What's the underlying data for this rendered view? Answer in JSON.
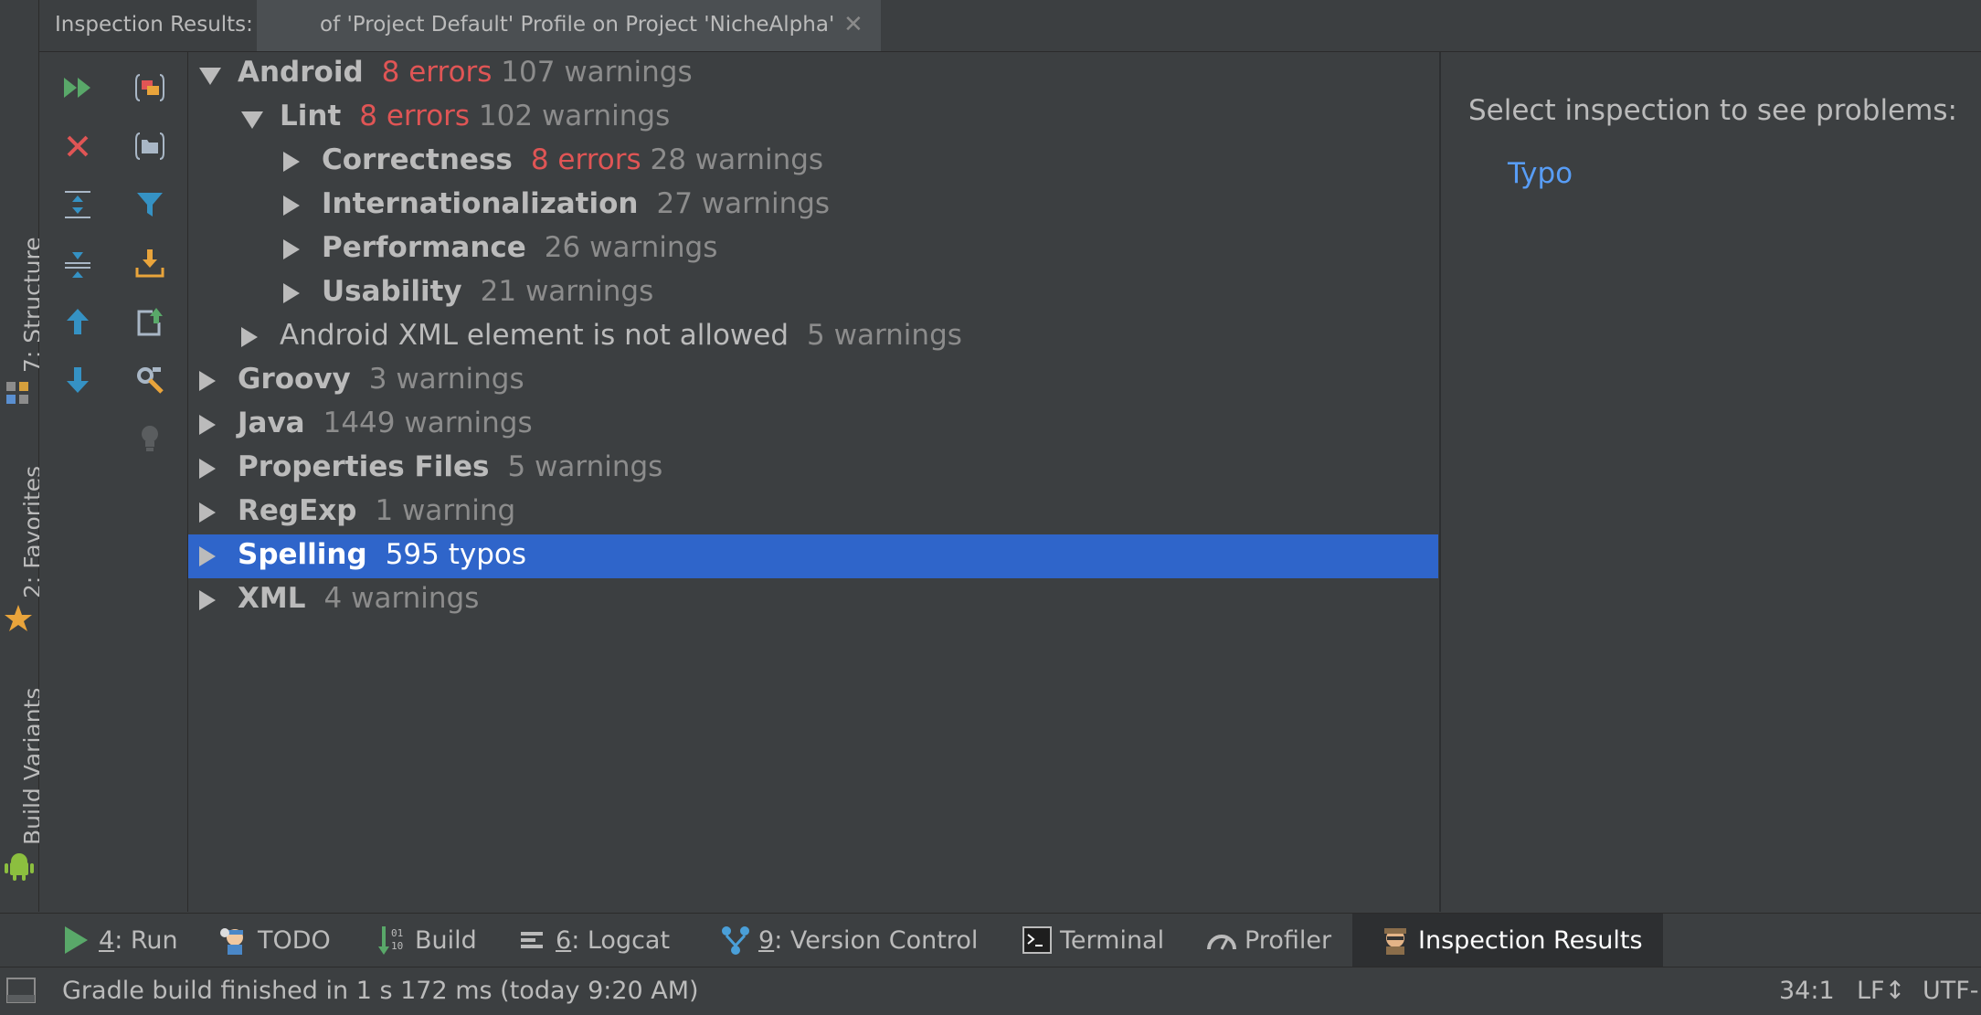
{
  "tool_window_tabs_left": [
    {
      "number": "7",
      "label": ": Structure"
    },
    {
      "number": "2",
      "label": ": Favorites"
    },
    {
      "number": "",
      "label": "Build Variants"
    }
  ],
  "header": {
    "label": "Inspection Results:",
    "tab_title": "of 'Project Default' Profile on Project 'NicheAlpha'",
    "close_glyph": "✕"
  },
  "toolbar": {
    "icons": [
      "rerun-icon",
      "close-icon",
      "expand-all-icon",
      "collapse-all-icon",
      "previous-problem-icon",
      "next-problem-icon",
      "group-by-severity-icon",
      "group-by-directory-icon",
      "filter-icon",
      "import-icon",
      "export-icon",
      "settings-icon",
      "quick-fix-bulb-icon"
    ]
  },
  "tree": {
    "rows": [
      {
        "label": "Android",
        "errors": "8 errors",
        "warnings": "107 warnings",
        "expanded": true
      },
      {
        "label": "Lint",
        "errors": "8 errors",
        "warnings": "102 warnings",
        "expanded": true
      },
      {
        "label": "Correctness",
        "errors": "8 errors",
        "warnings": "28 warnings"
      },
      {
        "label": "Internationalization",
        "warnings": "27 warnings"
      },
      {
        "label": "Performance",
        "warnings": "26 warnings"
      },
      {
        "label": "Usability",
        "warnings": "21 warnings"
      },
      {
        "label": "Android XML element is not allowed",
        "warnings": "5 warnings"
      },
      {
        "label": "Groovy",
        "warnings": "3 warnings"
      },
      {
        "label": "Java",
        "warnings": "1449 warnings"
      },
      {
        "label": "Properties Files",
        "warnings": "5 warnings"
      },
      {
        "label": "RegExp",
        "warnings": "1 warning"
      },
      {
        "label": "Spelling",
        "warnings": "595 typos",
        "selected": true
      },
      {
        "label": "XML",
        "warnings": "4 warnings"
      }
    ]
  },
  "right_panel": {
    "hint": "Select inspection to see problems:",
    "link": "Typo"
  },
  "bottom_tabs": [
    {
      "number": "4",
      "label": ": Run",
      "icon": "run-icon"
    },
    {
      "number": "",
      "label": "TODO",
      "icon": "todo-icon"
    },
    {
      "number": "",
      "label": "Build",
      "icon": "build-icon"
    },
    {
      "number": "6",
      "label": ": Logcat",
      "icon": "logcat-icon"
    },
    {
      "number": "9",
      "label": ": Version Control",
      "icon": "version-control-icon"
    },
    {
      "number": "",
      "label": "Terminal",
      "icon": "terminal-icon"
    },
    {
      "number": "",
      "label": "Profiler",
      "icon": "profiler-icon"
    },
    {
      "number": "",
      "label": "Inspection Results",
      "icon": "inspector-icon",
      "active": true
    }
  ],
  "status_bar": {
    "message": "Gradle build finished in 1 s 172 ms (today 9:20 AM)",
    "position": "34:1",
    "line_ending": "LF↕",
    "encoding": "UTF-"
  },
  "colors": {
    "background": "#3c3f41",
    "selection": "#2f65ca",
    "error": "#e05555",
    "warning_gray": "#8c8c8c",
    "link": "#589df6"
  }
}
